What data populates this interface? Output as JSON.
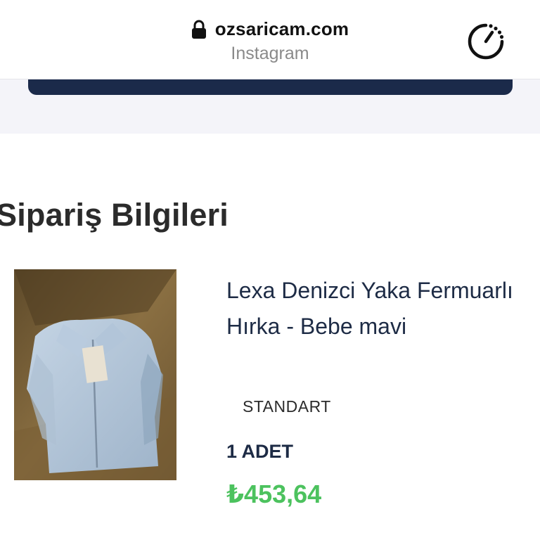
{
  "browser": {
    "url": "ozsaricam.com",
    "subtitle": "Instagram",
    "icons": {
      "lock": "lock-icon",
      "timer": "timer-icon"
    }
  },
  "order": {
    "section_title": "Sipariş Bilgileri",
    "product": {
      "name": "Lexa Denizci Yaka Fermuarlı Hırka - Bebe mavi",
      "variant": "STANDART",
      "quantity": "1 ADET",
      "price": "₺453,64"
    }
  },
  "colors": {
    "button_dark": "#1b2a4a",
    "price_green": "#4cc25e",
    "strip_bg": "#f4f4f9"
  }
}
